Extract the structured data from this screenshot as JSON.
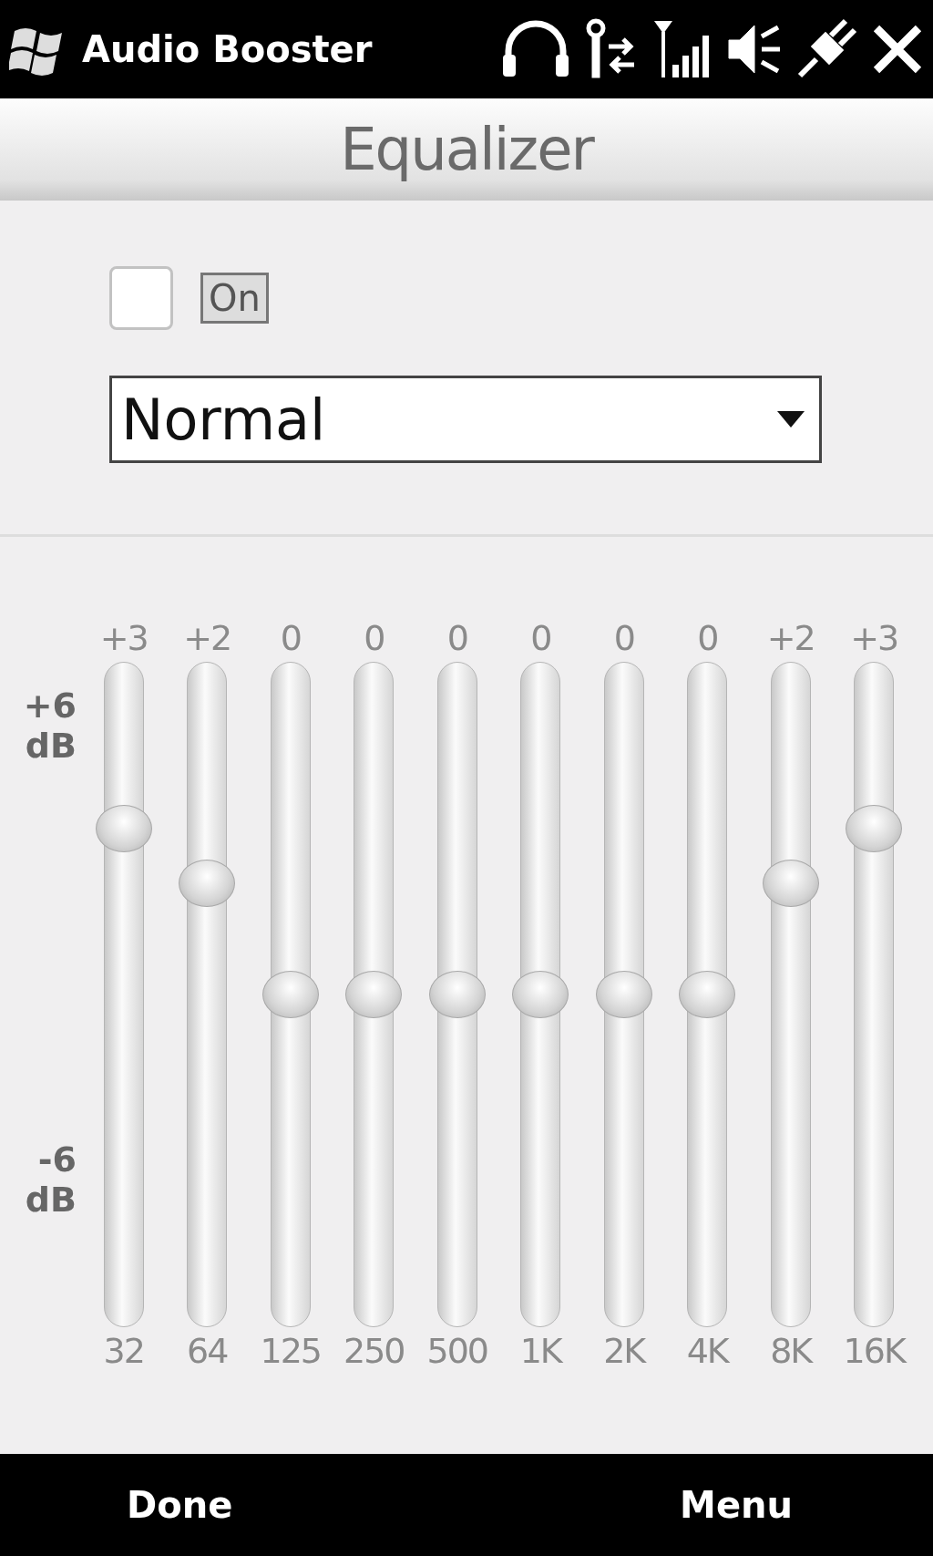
{
  "status_bar": {
    "title": "Audio Booster"
  },
  "header": {
    "title": "Equalizer"
  },
  "power": {
    "checked": false,
    "label": "On"
  },
  "preset": {
    "value": "Normal"
  },
  "scale": {
    "top": "+6 dB",
    "bottom": "-6 dB"
  },
  "bands": [
    {
      "value": "+3",
      "freq": "32",
      "level": 0.75
    },
    {
      "value": "+2",
      "freq": "64",
      "level": 0.667
    },
    {
      "value": "0",
      "freq": "125",
      "level": 0.5
    },
    {
      "value": "0",
      "freq": "250",
      "level": 0.5
    },
    {
      "value": "0",
      "freq": "500",
      "level": 0.5
    },
    {
      "value": "0",
      "freq": "1K",
      "level": 0.5
    },
    {
      "value": "0",
      "freq": "2K",
      "level": 0.5
    },
    {
      "value": "0",
      "freq": "4K",
      "level": 0.5
    },
    {
      "value": "+2",
      "freq": "8K",
      "level": 0.667
    },
    {
      "value": "+3",
      "freq": "16K",
      "level": 0.75
    }
  ],
  "softkeys": [
    "Done",
    "Menu"
  ]
}
